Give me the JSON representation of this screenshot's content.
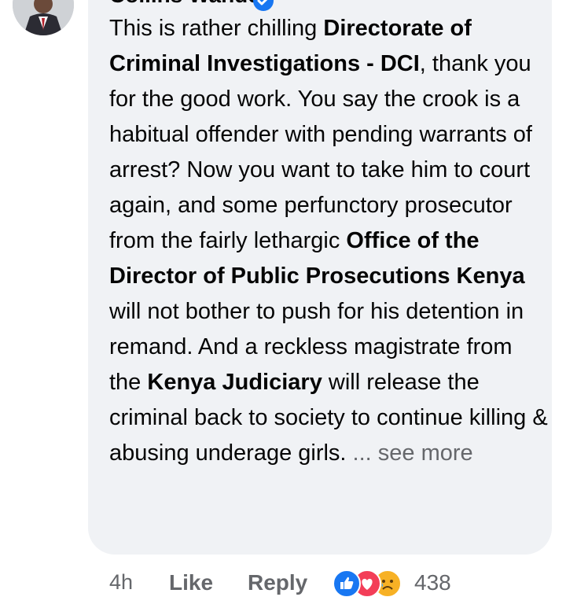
{
  "comment": {
    "author": "Collins Wanderi",
    "segments": [
      {
        "text": "This is rather chilling ",
        "bold": false
      },
      {
        "text": "Directorate of Criminal Investigations - DCI",
        "bold": true
      },
      {
        "text": ", thank you for the good work. You say the crook is a habitual offender with pending warrants of arrest? Now you want to take him to court again, and some perfunctory prosecutor from the fairly lethargic ",
        "bold": false
      },
      {
        "text": "Office of the Director of Public Prosecutions Kenya",
        "bold": true
      },
      {
        "text": " will not bother to push for his detention in remand. And a reckless magistrate from the ",
        "bold": false
      },
      {
        "text": "Kenya Judiciary",
        "bold": true
      },
      {
        "text": " will release the criminal back to society to continue killing & abusing underage girls. ",
        "bold": false
      }
    ],
    "see_more": "... see more"
  },
  "footer": {
    "time": "4h",
    "like_label": "Like",
    "reply_label": "Reply",
    "reaction_icons": [
      "like-icon",
      "love-icon",
      "sad-icon"
    ],
    "reaction_count": "438"
  },
  "colors": {
    "bubble": "#f0f2f5",
    "text": "#050505",
    "muted": "#65676b",
    "like": "#1877f2",
    "love": "#f33e58",
    "sad": "#f7b125"
  }
}
